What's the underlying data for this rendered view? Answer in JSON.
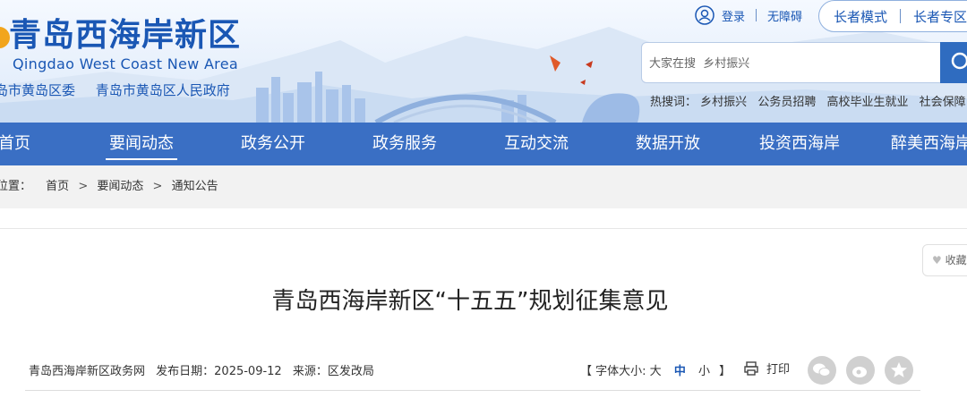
{
  "site": {
    "title_cn": "青岛西海岸新区",
    "title_en": "Qingdao West Coast New Area",
    "sub_links": [
      "岛市黄岛区委",
      "青岛市黄岛区人民政府"
    ]
  },
  "top_tools": {
    "login": "登录",
    "accessibility": "无障碍",
    "elder_mode": "长者模式",
    "elder_zone": "长者专区"
  },
  "search": {
    "placeholder": "大家在搜  乡村振兴"
  },
  "hot": {
    "label": "热搜词：",
    "items": [
      "乡村振兴",
      "公务员招聘",
      "高校毕业生就业",
      "社会保障"
    ]
  },
  "nav": {
    "items": [
      "首页",
      "要闻动态",
      "政务公开",
      "政务服务",
      "互动交流",
      "数据开放",
      "投资西海岸",
      "醉美西海岸"
    ],
    "active": "要闻动态"
  },
  "breadcrumb": {
    "prefix": "位置：",
    "items": [
      "首页",
      "要闻动态",
      "通知公告"
    ],
    "sep": ">"
  },
  "article": {
    "title": "青岛西海岸新区“十五五”规划征集意见",
    "site": "青岛西海岸新区政务网",
    "date_label": "发布日期：2025-09-12",
    "source_label": "来源：区发改局",
    "font_size_label": "【 字体大小: ",
    "font_large": "大",
    "font_medium": "中",
    "font_small": "小",
    "font_size_end": "】",
    "print_label": "打印",
    "fav_label": "收藏"
  },
  "colors": {
    "brand": "#1a57b4",
    "nav_bg": "#3a6fc4",
    "crumb_bg": "#f2f2f2"
  }
}
